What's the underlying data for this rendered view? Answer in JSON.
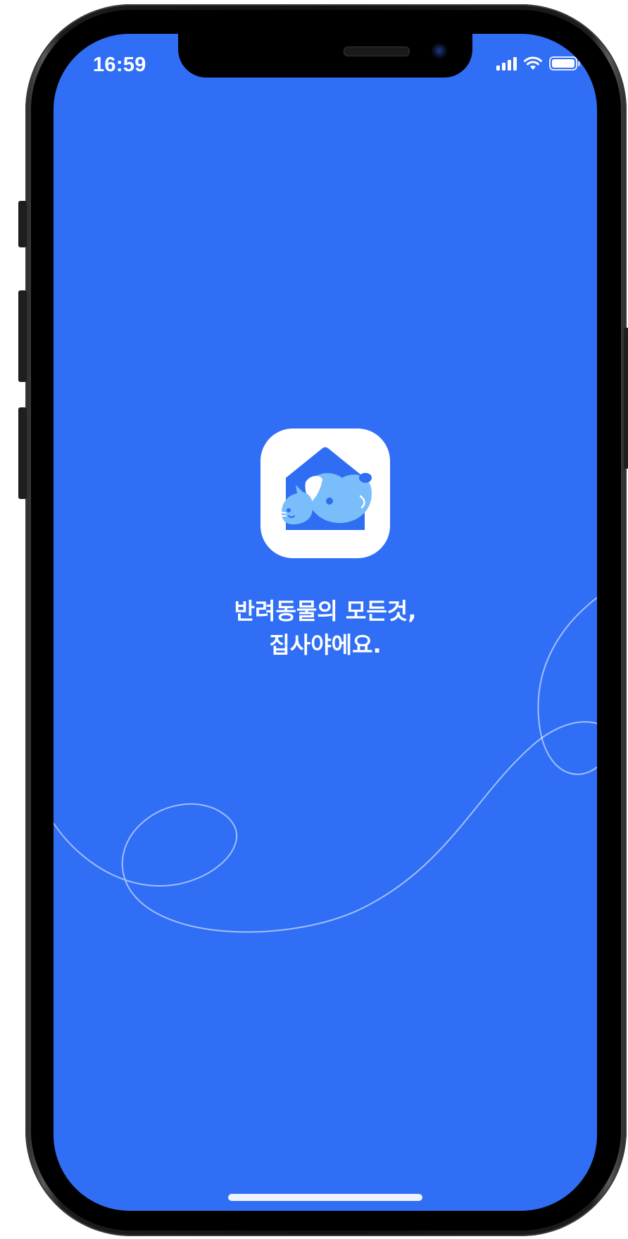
{
  "status_bar": {
    "time": "16:59",
    "signal_icon": "cellular-signal-icon",
    "wifi_icon": "wifi-icon",
    "battery_icon": "battery-icon",
    "battery_level": 1.0
  },
  "splash": {
    "background_color": "#306ff5",
    "logo_icon": "app-logo-house-pets-icon",
    "tagline_line1": "반려동물의 모든것,",
    "tagline_line2": "집사야에요."
  },
  "colors": {
    "brand_blue": "#306ff5",
    "logo_dark_blue": "#2f6ef2",
    "logo_light_blue": "#79bdfa",
    "white": "#ffffff"
  }
}
